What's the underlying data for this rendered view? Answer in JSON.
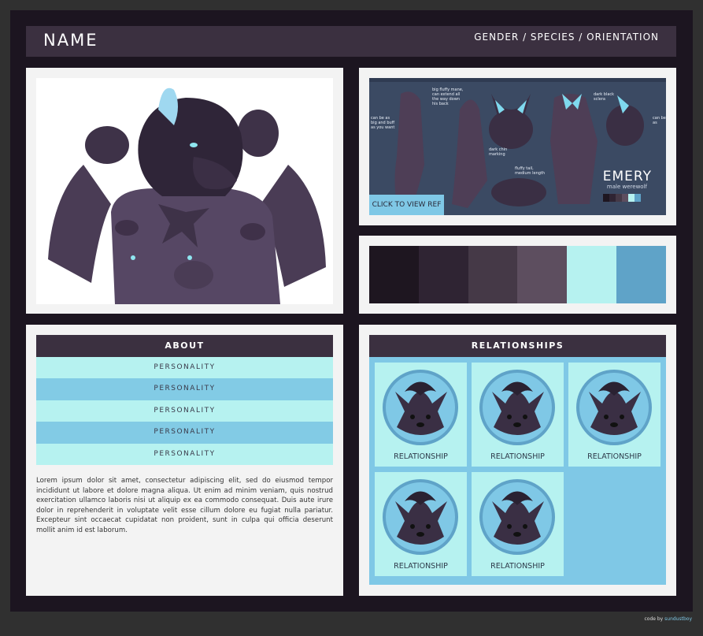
{
  "header": {
    "name": "NAME",
    "gender_species_orientation": "GENDER / SPECIES / ORIENTATION"
  },
  "reference": {
    "button_label": "CLICK TO VIEW REF",
    "character_name": "EMERY",
    "character_sub": "male werewolf",
    "notes": [
      "big fluffy mane, can extend all the way down his back",
      "dark black sclera",
      "can be as big and buff as you want",
      "dark chin marking",
      "fluffy tail, medium length",
      "can be as"
    ]
  },
  "palette": {
    "colors": [
      "#1e1620",
      "#2f2433",
      "#453947",
      "#5d4e5f",
      "#b6f2f0",
      "#5fa3c8"
    ]
  },
  "about": {
    "title": "ABOUT",
    "rows": [
      "PERSONALITY",
      "PERSONALITY",
      "PERSONALITY",
      "PERSONALITY",
      "PERSONALITY"
    ],
    "text": "Lorem ipsum dolor sit amet, consectetur adipiscing elit, sed do eiusmod tempor incididunt ut labore et dolore magna aliqua. Ut enim ad minim veniam, quis nostrud exercitation ullamco laboris nisi ut aliquip ex ea commodo consequat. Duis aute irure dolor in reprehenderit in voluptate velit esse cillum dolore eu fugiat nulla pariatur. Excepteur sint occaecat cupidatat non proident, sunt in culpa qui officia deserunt mollit anim id est laborum."
  },
  "relationships": {
    "title": "RELATIONSHIPS",
    "cards": [
      {
        "label": "RELATIONSHIP"
      },
      {
        "label": "RELATIONSHIP"
      },
      {
        "label": "RELATIONSHIP"
      },
      {
        "label": "RELATIONSHIP"
      },
      {
        "label": "RELATIONSHIP"
      }
    ]
  },
  "credit": {
    "prefix": "code by",
    "author": "sundustboy"
  },
  "colors": {
    "background": "#303030",
    "frame": "#1c1520",
    "bar": "#3b3040",
    "panel": "#f3f3f3",
    "light_cyan": "#b6f2f0",
    "sky_blue": "#82cbe5"
  }
}
